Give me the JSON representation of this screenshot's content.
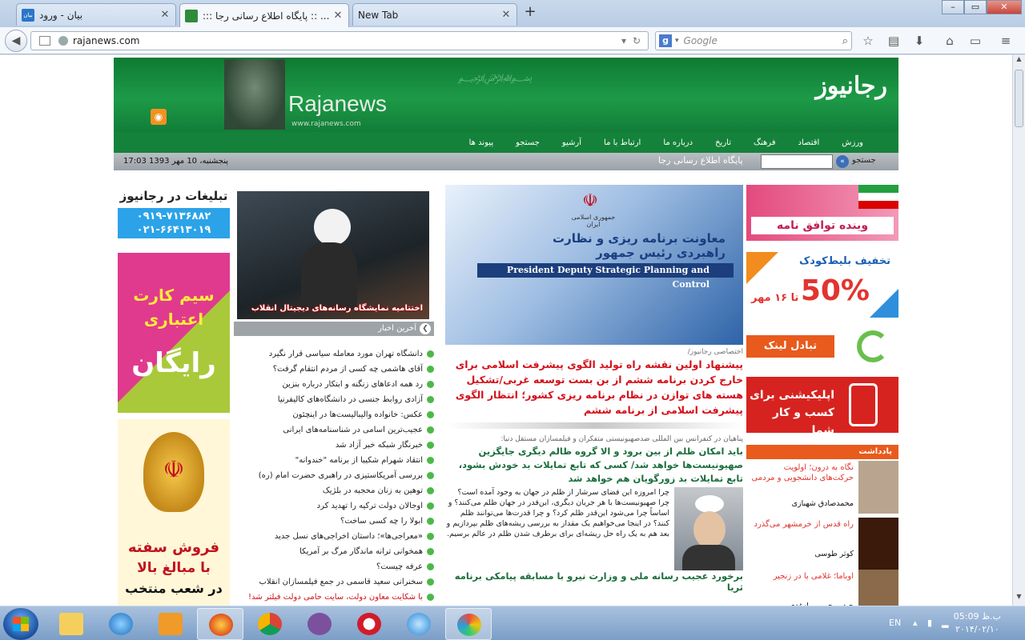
{
  "browser": {
    "tabs": [
      {
        "title": "بیان - ورود",
        "favicon_color": "#2a76c8",
        "favicon_text": "بیان"
      },
      {
        "title": "::: پایگاه اطلاع رسانی رجا :: ...",
        "favicon_color": "#2e8b3a"
      },
      {
        "title": "New Tab",
        "favicon_color": ""
      }
    ],
    "url": "rajanews.com",
    "search_placeholder": "Google",
    "window_controls": {
      "minimize": "–",
      "maximize": "▭",
      "close": "✕"
    }
  },
  "site": {
    "logo": "رجانیوز",
    "header_wordmark": "Rajanews",
    "header_url": "www.rajanews.com",
    "menu": [
      "ورزش",
      "اقتصاد",
      "فرهنگ",
      "تاریخ",
      "درباره ما",
      "ارتباط با ما",
      "آرشیو",
      "جستجو",
      "پیوند ها"
    ],
    "date": "پنجشنبه، 10 مهر 1393 17:03",
    "slogan": "پایگاه اطلاع رسانی رجا",
    "search_label": "جستجو"
  },
  "left_ads": {
    "title": "تبلیغات در رجانیوز",
    "phone1": "۰۹۱۹-۷۱۳۶۸۸۲",
    "phone2": "۰۲۱-۶۶۴۱۳۰۱۹",
    "sim_line1": "سیم کارت",
    "sim_line2": "اعتباری",
    "sim_free": "رایگان",
    "bank_line1": "فروش سفته",
    "bank_line2": "با مبالغ بالا",
    "bank_line3": "در شعب منتخب"
  },
  "feature_photo_caption": "اختتامیه نمایشگاه رسانه‌های دیجیتال انقلاب",
  "latest": {
    "heading": "آخرین اخبار",
    "items": [
      {
        "text": "دانشگاه تهران مورد معامله سیاسی قرار نگیرد",
        "red": false
      },
      {
        "text": "آقای هاشمی چه کسی از مردم انتقام گرفت؟",
        "red": false
      },
      {
        "text": "رد همه ادعاهای زنگنه و ابتکار درباره بنزین",
        "red": false
      },
      {
        "text": "آزادی روابط جنسی در دانشگاه‌های کالیفرنیا",
        "red": false
      },
      {
        "text": "عکس: خانواده والیبالیست‌ها در اینچئون",
        "red": false
      },
      {
        "text": "عجیب‌ترین اسامی در شناسنامه‌های ایرانی",
        "red": false
      },
      {
        "text": "خبرنگار شبکه خبر آزاد شد",
        "red": false
      },
      {
        "text": "انتقاد شهرام شکیبا از برنامه \"خندوانه\"",
        "red": false
      },
      {
        "text": "بررسی آمریکاستیزی در راهبری حضرت امام (ره)",
        "red": false
      },
      {
        "text": "توهین به زنان محجبه در بلژیک",
        "red": false
      },
      {
        "text": "اوجالان دولت ترکیه را تهدید کرد",
        "red": false
      },
      {
        "text": "ابولا را چه کسی ساخت؟",
        "red": false
      },
      {
        "text": "«معراجی‌ها»؛ داستان اخراجی‌های نسل جدید",
        "red": false
      },
      {
        "text": "همخوانی ترانه ماندگار مرگ بر آمریکا",
        "red": false
      },
      {
        "text": "عرفه چیست؟",
        "red": false
      },
      {
        "text": "سخنرانی سعید قاسمی در جمع فیلمسازان انقلاب",
        "red": false
      },
      {
        "text": "با شکایت معاون دولت، سایت حامی دولت فیلتر شد!",
        "red": true
      }
    ]
  },
  "banner": {
    "small": "جمهوری اسلامی ایران",
    "fa": "معاونت برنامه ریزی و نظارت راهبردی رئیس جمهور",
    "en": "President Deputy Strategic Planning and Control"
  },
  "center": {
    "tag": "اختصاصی رجانیوز/",
    "headline": "پیشنهاد اولین نقشه راه تولید الگوی پیشرفت اسلامی برای خارج کردن برنامه ششم از بن بست توسعه غربی/تشکیل هسته های توازن در نظام برنامه ریزی کشور؛ انتظار الگوی پیشرفت اسلامی از برنامه ششم",
    "kicker": "پناهیان در کنفرانس بین المللی ضدصهیونیستی متفکران و فیلمسازان مستقل دنیا:",
    "headline2": "باید امکان ظلم از بین برود و الا گروه ظالم دیگری جایگزین صهیونیست‌ها خواهد شد/ کسی که تابع تمایلات بد خودش بشود، تابع تمایلات بد زورگویان هم خواهد شد",
    "body": "چرا امروزه این فضای سرشار از ظلم در جهان به وجود آمده است؟ چرا صهیونیست‌ها با هر جریان دیگری، این‌قدر در جهان ظلم می‌کنند؟ و اساساً چرا می‌شود این‌قدر ظلم کرد؟ و چرا قدرت‌ها می‌توانند ظلم کنند؟ در اینجا می‌خواهیم یک مقدار به بررسی ریشه‌های ظلم بپردازیم و بعد هم به یک راه حل ریشه‌ای برای برطرف شدن ظلم در عالم برسیم.",
    "headline3": "برخورد عجیب رسانه ملی و وزارت نیرو با مسابقه پیامکی برنامه ثریا"
  },
  "right_ads": {
    "ad1": "وینده توافق نامه",
    "ad2_title": "تخفیف بلیط‌کودک",
    "ad2_pct": "50%",
    "ad2_until": "تا ۱۶ مهر",
    "ad3": "تبادل لینک",
    "ad4": "اپلیکیشنی برای کسب و کار شما"
  },
  "notes": {
    "heading": "یادداشت",
    "items": [
      {
        "title": "نگاه به درون؛ اولویت حرکت‌های دانشجویی و مردمی",
        "author": "محمدصادق شهبازی",
        "color": "#b9a58f"
      },
      {
        "title": "راه قدس از خرمشهر می‌گذرد",
        "author": "کوثر طوسی",
        "color": "#3b1a0c"
      },
      {
        "title": "اوباما؛ غلامی با در زنجیر",
        "author": "حیدر رحیم‌پور ازغدی",
        "color": "#8a6a4a"
      }
    ]
  },
  "taskbar": {
    "lang": "EN",
    "time": "05:09 ب.ظ",
    "date": "۲۰۱۴/۰۲/۱۰"
  }
}
